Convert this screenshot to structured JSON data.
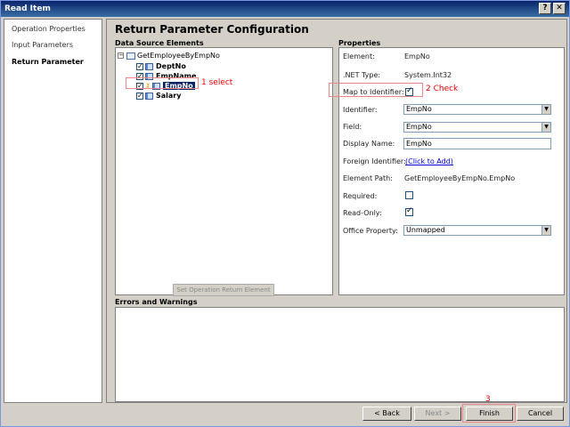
{
  "window": {
    "title": "Read Item",
    "help_button": "?",
    "close_button": "✕"
  },
  "nav": {
    "items": [
      {
        "label": "Operation Properties"
      },
      {
        "label": "Input Parameters"
      },
      {
        "label": "Return Parameter"
      }
    ]
  },
  "main": {
    "heading": "Return Parameter Configuration",
    "data_source_label": "Data Source Elements",
    "properties_label": "Properties",
    "errors_label": "Errors and Warnings",
    "set_button": "Set Operation Return Element"
  },
  "tree": {
    "root": "GetEmployeeByEmpNo",
    "items": [
      {
        "label": "DeptNo",
        "checked": true
      },
      {
        "label": "EmpName",
        "checked": true
      },
      {
        "label": "EmpNo",
        "checked": true,
        "selected": true
      },
      {
        "label": "Salary",
        "checked": true
      }
    ]
  },
  "properties": {
    "element_label": "Element:",
    "element_value": "EmpNo",
    "nettype_label": ".NET Type:",
    "nettype_value": "System.Int32",
    "map_label": "Map to Identifier:",
    "identifier_label": "Identifier:",
    "identifier_value": "EmpNo",
    "field_label": "Field:",
    "field_value": "EmpNo",
    "display_label": "Display Name:",
    "display_value": "EmpNo",
    "foreign_label": "Foreign Identifier:",
    "foreign_value": "(Click to Add)",
    "path_label": "Element Path:",
    "path_value": "GetEmployeeByEmpNo.EmpNo",
    "required_label": "Required:",
    "readonly_label": "Read-Only:",
    "office_label": "Office Property:",
    "office_value": "Unmapped"
  },
  "annotations": {
    "select": "1 select",
    "check": "2 Check",
    "finish": "3"
  },
  "buttons": {
    "back": "< Back",
    "next": "Next >",
    "finish": "Finish",
    "cancel": "Cancel"
  }
}
